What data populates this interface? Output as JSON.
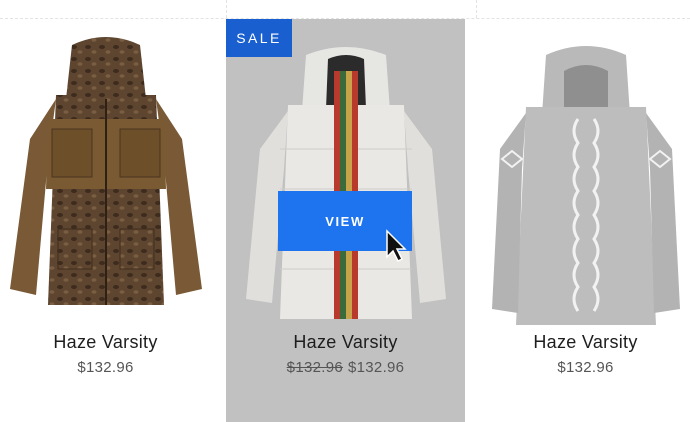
{
  "products": [
    {
      "title": "Haze Varsity",
      "price": "$132.96",
      "image_icon": "brown-camo-parka-image"
    },
    {
      "title": "Haze Varsity",
      "old_price": "$132.96",
      "price": "$132.96",
      "badge": "SALE",
      "action": "VIEW",
      "image_icon": "white-puffer-jacket-image"
    },
    {
      "title": "Haze Varsity",
      "price": "$132.96",
      "image_icon": "grey-knit-ski-jacket-image"
    }
  ],
  "colors": {
    "accent": "#1e73ee",
    "badge": "#1a5fd0",
    "hover_bg": "#c1c1c1"
  }
}
